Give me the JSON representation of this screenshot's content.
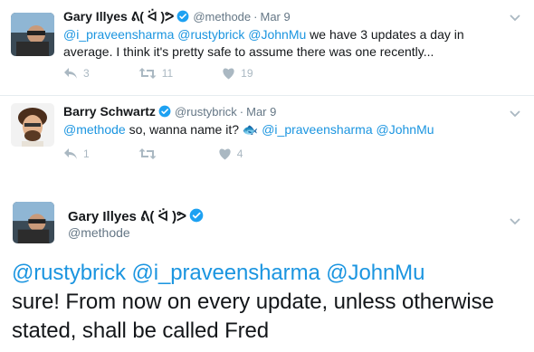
{
  "tweets": [
    {
      "name": "Gary Illyes ᕕ( ᐛ )ᕗ",
      "handle": "@methode",
      "dot": "·",
      "time": "Mar 9",
      "mentions": "@i_praveensharma @rustybrick @JohnMu",
      "text": " we have 3 updates a day in average. I think it's pretty safe to assume there was one recently...",
      "reply_count": "3",
      "retweet_count": "11",
      "like_count": "19"
    },
    {
      "name": "Barry Schwartz",
      "handle": "@rustybrick",
      "dot": "·",
      "time": "Mar 9",
      "mention_start": "@methode",
      "text_mid": " so, wanna name it? 🐟 ",
      "mentions_end": "@i_praveensharma @JohnMu",
      "reply_count": "1",
      "retweet_count": "",
      "like_count": "4"
    }
  ],
  "main_tweet": {
    "name": "Gary Illyes ᕕ( ᐛ )ᕗ",
    "handle": "@methode",
    "mentions": "@rustybrick @i_praveensharma @JohnMu",
    "text": "sure! From now on every update, unless otherwise stated, shall be called Fred"
  },
  "colors": {
    "link": "#1b95e0",
    "verified": "#1da1f2",
    "action": "#aab8c2",
    "meta": "#657786"
  },
  "icons": [
    "verified-icon",
    "reply-icon",
    "retweet-icon",
    "like-icon",
    "chevron-down-icon"
  ]
}
